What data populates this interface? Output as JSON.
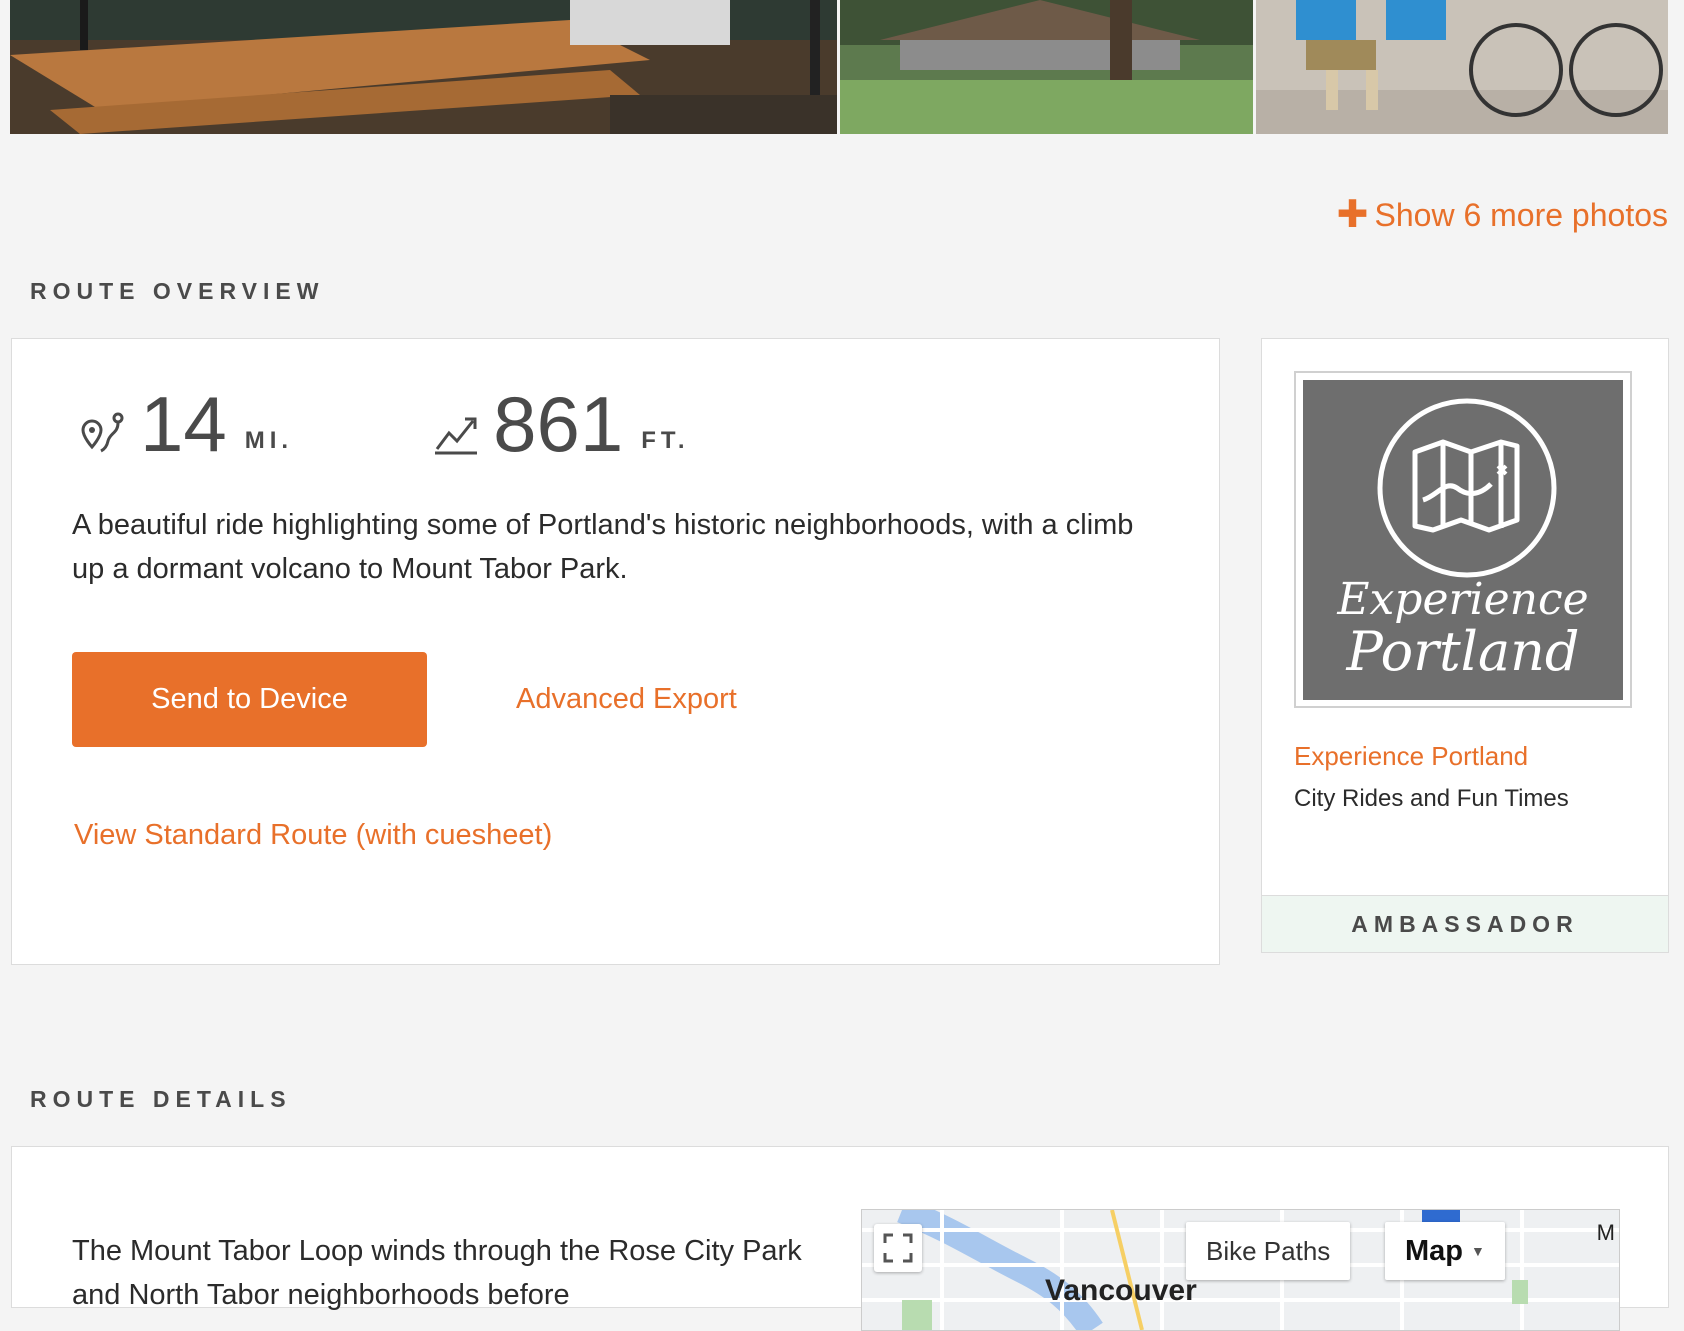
{
  "photos": {
    "more_photos_label": "Show 6 more photos"
  },
  "overview": {
    "section_label": "ROUTE OVERVIEW",
    "distance_value": "14",
    "distance_unit": "MI.",
    "elevation_value": "861",
    "elevation_unit": "FT.",
    "description": "A beautiful ride highlighting some of Portland's historic neighborhoods, with a climb up a dormant volcano to Mount Tabor Park.",
    "send_button": "Send to Device",
    "advanced_export": "Advanced Export",
    "standard_route": "View Standard Route (with cuesheet)"
  },
  "ambassador": {
    "logo_line1": "Experience",
    "logo_line2": "Portland",
    "name": "Experience Portland",
    "tagline": "City Rides and Fun Times",
    "badge": "AMBASSADOR"
  },
  "details": {
    "section_label": "ROUTE DETAILS",
    "text": "The Mount Tabor Loop winds through the Rose City Park and North Tabor neighborhoods before",
    "map": {
      "bike_paths_button": "Bike Paths",
      "map_type_button": "Map",
      "place_label": "Vancouver",
      "corner_label": "M"
    }
  },
  "colors": {
    "accent": "#e8702a",
    "background": "#f4f4f4",
    "ambassador_footer": "#eef6f1"
  },
  "icons": {
    "distance": "route-pin-icon",
    "elevation": "elevation-chart-icon",
    "plus": "plus-icon",
    "fullscreen": "fullscreen-icon",
    "logo": "map-icon"
  }
}
